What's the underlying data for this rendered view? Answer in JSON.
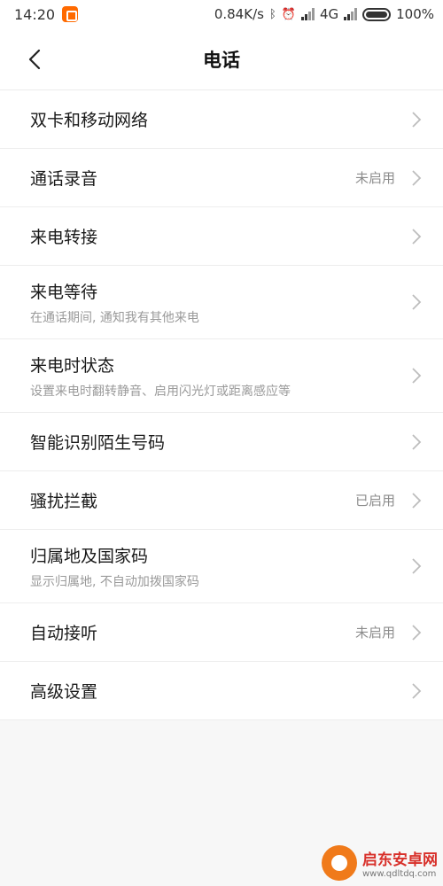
{
  "statusbar": {
    "time": "14:20",
    "speed": "0.84K/s",
    "network": "4G",
    "battery": "100%"
  },
  "header": {
    "title": "电话"
  },
  "items": [
    {
      "title": "双卡和移动网络",
      "subtitle": "",
      "status": ""
    },
    {
      "title": "通话录音",
      "subtitle": "",
      "status": "未启用"
    },
    {
      "title": "来电转接",
      "subtitle": "",
      "status": ""
    },
    {
      "title": "来电等待",
      "subtitle": "在通话期间, 通知我有其他来电",
      "status": ""
    },
    {
      "title": "来电时状态",
      "subtitle": "设置来电时翻转静音、启用闪光灯或距离感应等",
      "status": ""
    },
    {
      "title": "智能识别陌生号码",
      "subtitle": "",
      "status": ""
    },
    {
      "title": "骚扰拦截",
      "subtitle": "",
      "status": "已启用"
    },
    {
      "title": "归属地及国家码",
      "subtitle": "显示归属地, 不自动加拨国家码",
      "status": ""
    },
    {
      "title": "自动接听",
      "subtitle": "",
      "status": "未启用"
    },
    {
      "title": "高级设置",
      "subtitle": "",
      "status": ""
    }
  ],
  "watermark": {
    "name": "启东安卓网",
    "url": "www.qdltdq.com"
  },
  "colors": {
    "background": "#f7f7f7",
    "surface": "#ffffff",
    "title_text": "#1a1a1a",
    "secondary_text": "#9a9a9a"
  }
}
